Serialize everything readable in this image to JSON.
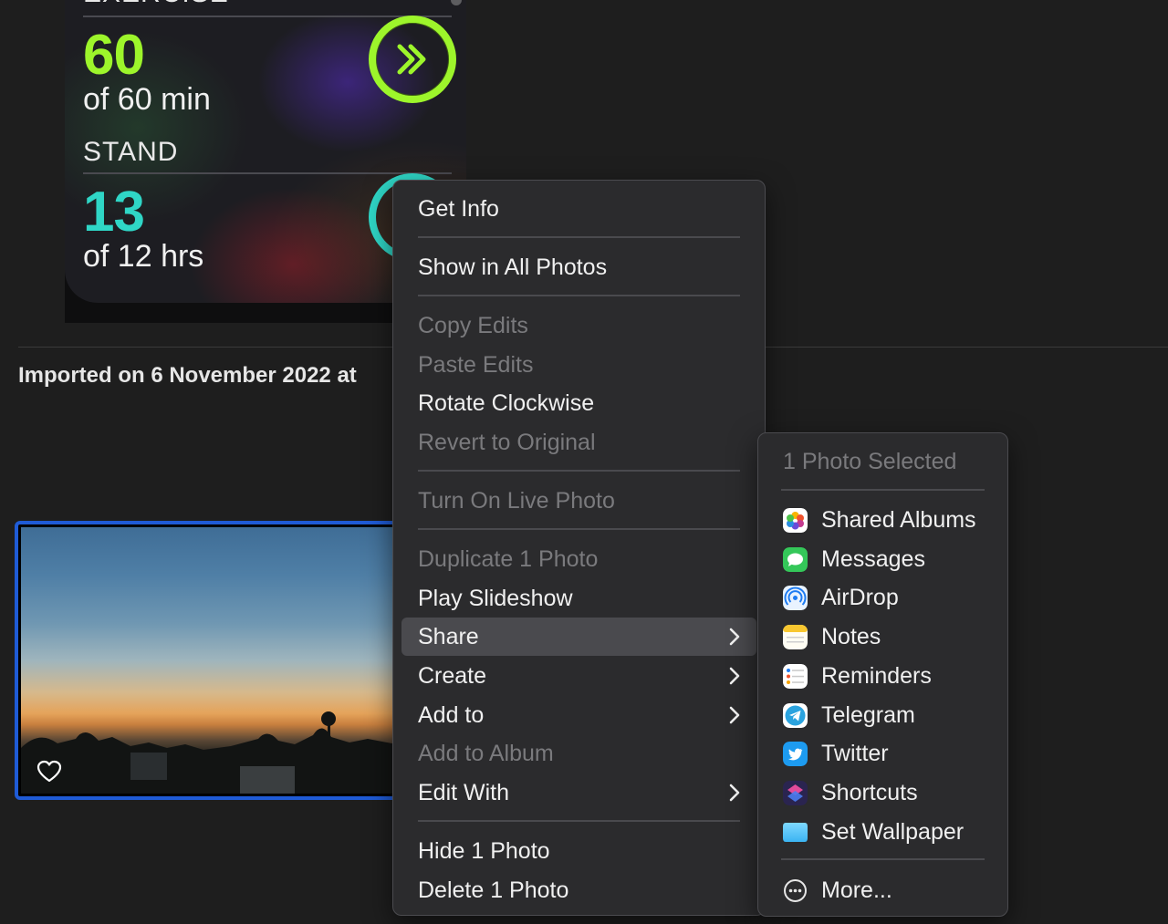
{
  "activity": {
    "exercise_label": "EXERCISE",
    "exercise_value": "60",
    "exercise_sub": "of 60 min",
    "stand_label": "STAND",
    "stand_value": "13",
    "stand_sub": "of 12 hrs",
    "colors": {
      "exercise": "#9df52b",
      "stand": "#2fd6c6"
    }
  },
  "library": {
    "imported_text": "Imported on 6 November 2022 at",
    "selection_color": "#1f5bd6"
  },
  "context_menu": {
    "items": [
      {
        "label": "Get Info",
        "enabled": true
      },
      {
        "label": "Show in All Photos",
        "enabled": true
      },
      {
        "label": "Copy Edits",
        "enabled": false
      },
      {
        "label": "Paste Edits",
        "enabled": false
      },
      {
        "label": "Rotate Clockwise",
        "enabled": true
      },
      {
        "label": "Revert to Original",
        "enabled": false
      },
      {
        "label": "Turn On Live Photo",
        "enabled": false
      },
      {
        "label": "Duplicate 1 Photo",
        "enabled": false
      },
      {
        "label": "Play Slideshow",
        "enabled": true
      },
      {
        "label": "Share",
        "enabled": true,
        "submenu": true,
        "highlighted": true
      },
      {
        "label": "Create",
        "enabled": true,
        "submenu": true
      },
      {
        "label": "Add to",
        "enabled": true,
        "submenu": true
      },
      {
        "label": "Add to Album",
        "enabled": false
      },
      {
        "label": "Edit With",
        "enabled": true,
        "submenu": true
      },
      {
        "label": "Hide 1 Photo",
        "enabled": true
      },
      {
        "label": "Delete 1 Photo",
        "enabled": true
      }
    ]
  },
  "share_menu": {
    "header": "1 Photo Selected",
    "items": [
      {
        "label": "Shared Albums",
        "icon": "photos-icon"
      },
      {
        "label": "Messages",
        "icon": "messages-icon"
      },
      {
        "label": "AirDrop",
        "icon": "airdrop-icon"
      },
      {
        "label": "Notes",
        "icon": "notes-icon"
      },
      {
        "label": "Reminders",
        "icon": "reminders-icon"
      },
      {
        "label": "Telegram",
        "icon": "telegram-icon"
      },
      {
        "label": "Twitter",
        "icon": "twitter-icon"
      },
      {
        "label": "Shortcuts",
        "icon": "shortcuts-icon"
      },
      {
        "label": "Set Wallpaper",
        "icon": "wallpaper-icon"
      }
    ],
    "more_label": "More..."
  }
}
